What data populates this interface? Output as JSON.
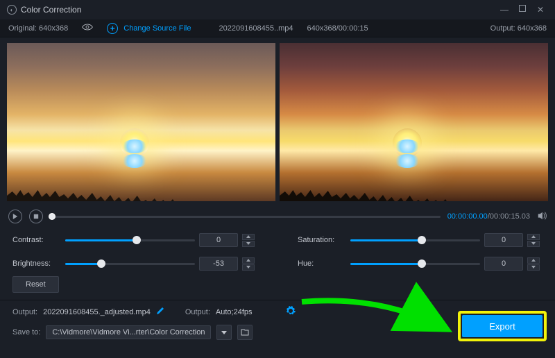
{
  "titlebar": {
    "title": "Color Correction"
  },
  "infobar": {
    "original_label": "Original:",
    "original_res": "640x368",
    "change_source_label": "Change Source File",
    "filename": "2022091608455..mp4",
    "file_meta": "640x368/00:00:15",
    "output_label": "Output:",
    "output_res": "640x368"
  },
  "playbar": {
    "current_time": "00:00:00.00",
    "total_time": "00:00:15.03",
    "progress_pct": 0.5
  },
  "adjust": {
    "contrast": {
      "label": "Contrast:",
      "value": "0",
      "pct": 55
    },
    "brightness": {
      "label": "Brightness:",
      "value": "-53",
      "pct": 28
    },
    "saturation": {
      "label": "Saturation:",
      "value": "0",
      "pct": 55
    },
    "hue": {
      "label": "Hue:",
      "value": "0",
      "pct": 55
    },
    "reset_label": "Reset"
  },
  "bottom": {
    "output_label": "Output:",
    "output_file": "2022091608455._adjusted.mp4",
    "fmt_label": "Output:",
    "fmt_value": "Auto;24fps",
    "save_label": "Save to:",
    "save_path": "C:\\Vidmore\\Vidmore Vi...rter\\Color Correction",
    "export_label": "Export"
  }
}
